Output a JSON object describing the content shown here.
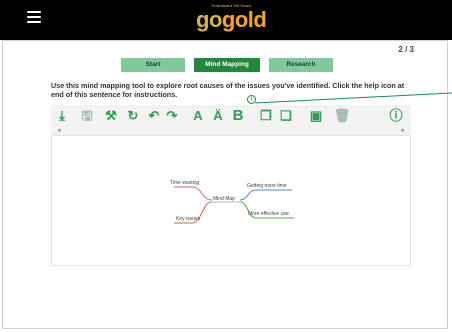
{
  "header": {
    "logo_tagline": "Gold Award Girl Scout",
    "logo_go": "go",
    "logo_gold": "gold",
    "menu_icon": "hamburger-menu-icon"
  },
  "progress": {
    "page_indicator": "2 / 3"
  },
  "tabs": [
    {
      "label": "Start",
      "active": false
    },
    {
      "label": "Mind Mapping",
      "active": true
    },
    {
      "label": "Research",
      "active": false
    }
  ],
  "instructions": {
    "text": "Use this mind mapping tool to explore root causes of the issues you've identified. Click the help icon at end of this sentence for instructions.",
    "help_icon": "info-icon"
  },
  "toolbar": {
    "icons": [
      {
        "name": "add-node-icon",
        "glyph": "⤓"
      },
      {
        "name": "save-icon",
        "glyph": "🖫"
      },
      {
        "name": "magic-wand-icon",
        "glyph": "⚒"
      },
      {
        "name": "refresh-icon",
        "glyph": "↻"
      },
      {
        "name": "undo-icon",
        "glyph": "↶"
      },
      {
        "name": "redo-icon",
        "glyph": "↷"
      },
      {
        "name": "font-size-decrease-icon",
        "glyph": "A"
      },
      {
        "name": "font-size-increase-icon",
        "glyph": "Ä"
      },
      {
        "name": "bold-icon",
        "glyph": "B"
      },
      {
        "name": "copy-icon",
        "glyph": "❐"
      },
      {
        "name": "paste-icon",
        "glyph": "❏"
      },
      {
        "name": "image-icon",
        "glyph": "▣"
      },
      {
        "name": "delete-icon",
        "glyph": "🗑"
      },
      {
        "name": "info-icon",
        "glyph": "ⓘ"
      }
    ],
    "scroll_left": "◂",
    "scroll_right": "▸"
  },
  "mind_map": {
    "center": "Mind Map",
    "nodes": [
      {
        "label": "Time wasting",
        "color": "#e05aa0"
      },
      {
        "label": "Key issues",
        "color": "#e8613a"
      },
      {
        "label": "Getting more time",
        "color": "#3d8fd6"
      },
      {
        "label": "More effective use",
        "color": "#4caf50"
      }
    ]
  },
  "colors": {
    "accent_green": "#1f8a3c",
    "tab_green": "#7fc99b",
    "toolbar_icon_green": "#2e9b57",
    "logo_gold": "#f4a623"
  }
}
